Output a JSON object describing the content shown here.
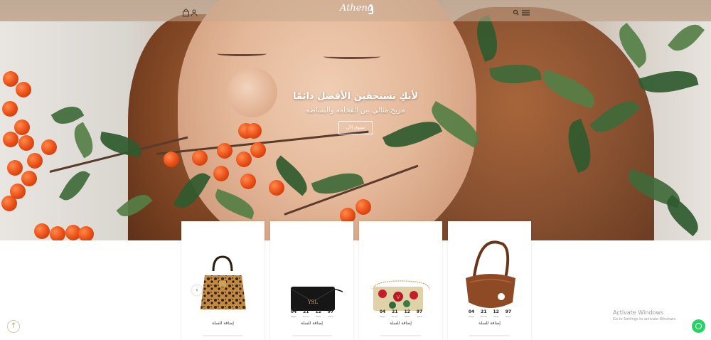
{
  "brand": {
    "logo_text": "Athena"
  },
  "header": {
    "icons": [
      "shopping-bag-icon",
      "user-icon",
      "search-icon",
      "menu-icon"
    ]
  },
  "hero": {
    "title": "لأنكِ تستحقين الأفضل دائمًا",
    "subtitle": "مزيج مثالي بين الفخامة والبساطة",
    "cta_label": "تسوق الآن"
  },
  "products": [
    {
      "image": "leopard-print-tote-bag",
      "add_to_cart": "إضافة للسلة",
      "countdown": []
    },
    {
      "image": "black-leather-envelope-clutch",
      "add_to_cart": "إضافة للسلة",
      "countdown": [
        {
          "value": "04",
          "unit": "Days"
        },
        {
          "value": "21",
          "unit": "Hours"
        },
        {
          "value": "12",
          "unit": "Mins"
        },
        {
          "value": "97",
          "unit": "Secs"
        }
      ]
    },
    {
      "image": "floral-embroidered-shoulder-bag",
      "add_to_cart": "إضافة للسلة",
      "countdown": [
        {
          "value": "04",
          "unit": "Days"
        },
        {
          "value": "21",
          "unit": "Hours"
        },
        {
          "value": "12",
          "unit": "Mins"
        },
        {
          "value": "97",
          "unit": "Secs"
        }
      ]
    },
    {
      "image": "brown-leather-crescent-bag",
      "add_to_cart": "إضافة للسلة",
      "countdown": [
        {
          "value": "04",
          "unit": "Days"
        },
        {
          "value": "21",
          "unit": "Hours"
        },
        {
          "value": "12",
          "unit": "Mins"
        },
        {
          "value": "97",
          "unit": "Secs"
        }
      ]
    }
  ],
  "activate_windows": {
    "title": "Activate Windows",
    "subtitle": "Go to Settings to activate Windows."
  },
  "colors": {
    "accent": "#b59a77",
    "whatsapp": "#25d366"
  }
}
